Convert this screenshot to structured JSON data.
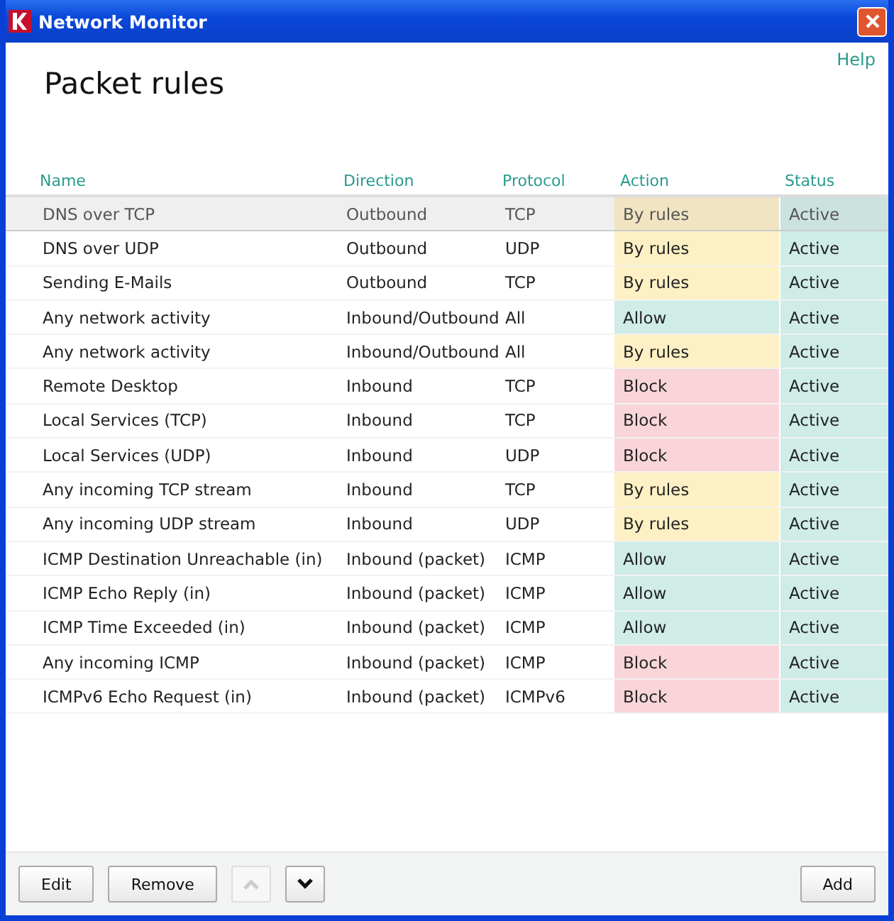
{
  "window": {
    "title": "Network Monitor"
  },
  "help_link": "Help",
  "heading": "Packet rules",
  "table": {
    "columns": [
      "Name",
      "Direction",
      "Protocol",
      "Action",
      "Status"
    ],
    "rows": [
      {
        "name": "DNS over TCP",
        "direction": "Outbound",
        "protocol": "TCP",
        "action": {
          "text": "By rules",
          "kind": "rules"
        },
        "status": "Active",
        "selected": true
      },
      {
        "name": "DNS over UDP",
        "direction": "Outbound",
        "protocol": "UDP",
        "action": {
          "text": "By rules",
          "kind": "rules"
        },
        "status": "Active",
        "selected": false
      },
      {
        "name": "Sending E-Mails",
        "direction": "Outbound",
        "protocol": "TCP",
        "action": {
          "text": "By rules",
          "kind": "rules"
        },
        "status": "Active",
        "selected": false
      },
      {
        "name": "Any network activity",
        "direction": "Inbound/Outbound",
        "protocol": "All",
        "action": {
          "text": "Allow",
          "kind": "allow"
        },
        "status": "Active",
        "selected": false
      },
      {
        "name": "Any network activity",
        "direction": "Inbound/Outbound",
        "protocol": "All",
        "action": {
          "text": "By rules",
          "kind": "rules"
        },
        "status": "Active",
        "selected": false
      },
      {
        "name": "Remote Desktop",
        "direction": "Inbound",
        "protocol": "TCP",
        "action": {
          "text": "Block",
          "kind": "block"
        },
        "status": "Active",
        "selected": false
      },
      {
        "name": "Local Services (TCP)",
        "direction": "Inbound",
        "protocol": "TCP",
        "action": {
          "text": "Block",
          "kind": "block"
        },
        "status": "Active",
        "selected": false
      },
      {
        "name": "Local Services (UDP)",
        "direction": "Inbound",
        "protocol": "UDP",
        "action": {
          "text": "Block",
          "kind": "block"
        },
        "status": "Active",
        "selected": false
      },
      {
        "name": "Any incoming TCP stream",
        "direction": "Inbound",
        "protocol": "TCP",
        "action": {
          "text": "By rules",
          "kind": "rules"
        },
        "status": "Active",
        "selected": false
      },
      {
        "name": "Any incoming UDP stream",
        "direction": "Inbound",
        "protocol": "UDP",
        "action": {
          "text": "By rules",
          "kind": "rules"
        },
        "status": "Active",
        "selected": false
      },
      {
        "name": "ICMP Destination Unreachable (in)",
        "direction": "Inbound (packet)",
        "protocol": "ICMP",
        "action": {
          "text": "Allow",
          "kind": "allow"
        },
        "status": "Active",
        "selected": false
      },
      {
        "name": "ICMP Echo Reply (in)",
        "direction": "Inbound (packet)",
        "protocol": "ICMP",
        "action": {
          "text": "Allow",
          "kind": "allow"
        },
        "status": "Active",
        "selected": false
      },
      {
        "name": "ICMP Time Exceeded (in)",
        "direction": "Inbound (packet)",
        "protocol": "ICMP",
        "action": {
          "text": "Allow",
          "kind": "allow"
        },
        "status": "Active",
        "selected": false
      },
      {
        "name": "Any incoming ICMP",
        "direction": "Inbound (packet)",
        "protocol": "ICMP",
        "action": {
          "text": "Block",
          "kind": "block"
        },
        "status": "Active",
        "selected": false
      },
      {
        "name": "ICMPv6 Echo Request (in)",
        "direction": "Inbound (packet)",
        "protocol": "ICMPv6",
        "action": {
          "text": "Block",
          "kind": "block"
        },
        "status": "Active",
        "selected": false
      }
    ]
  },
  "buttons": {
    "edit": "Edit",
    "remove": "Remove",
    "move_up_disabled": true,
    "move_down_disabled": false,
    "add": "Add"
  }
}
